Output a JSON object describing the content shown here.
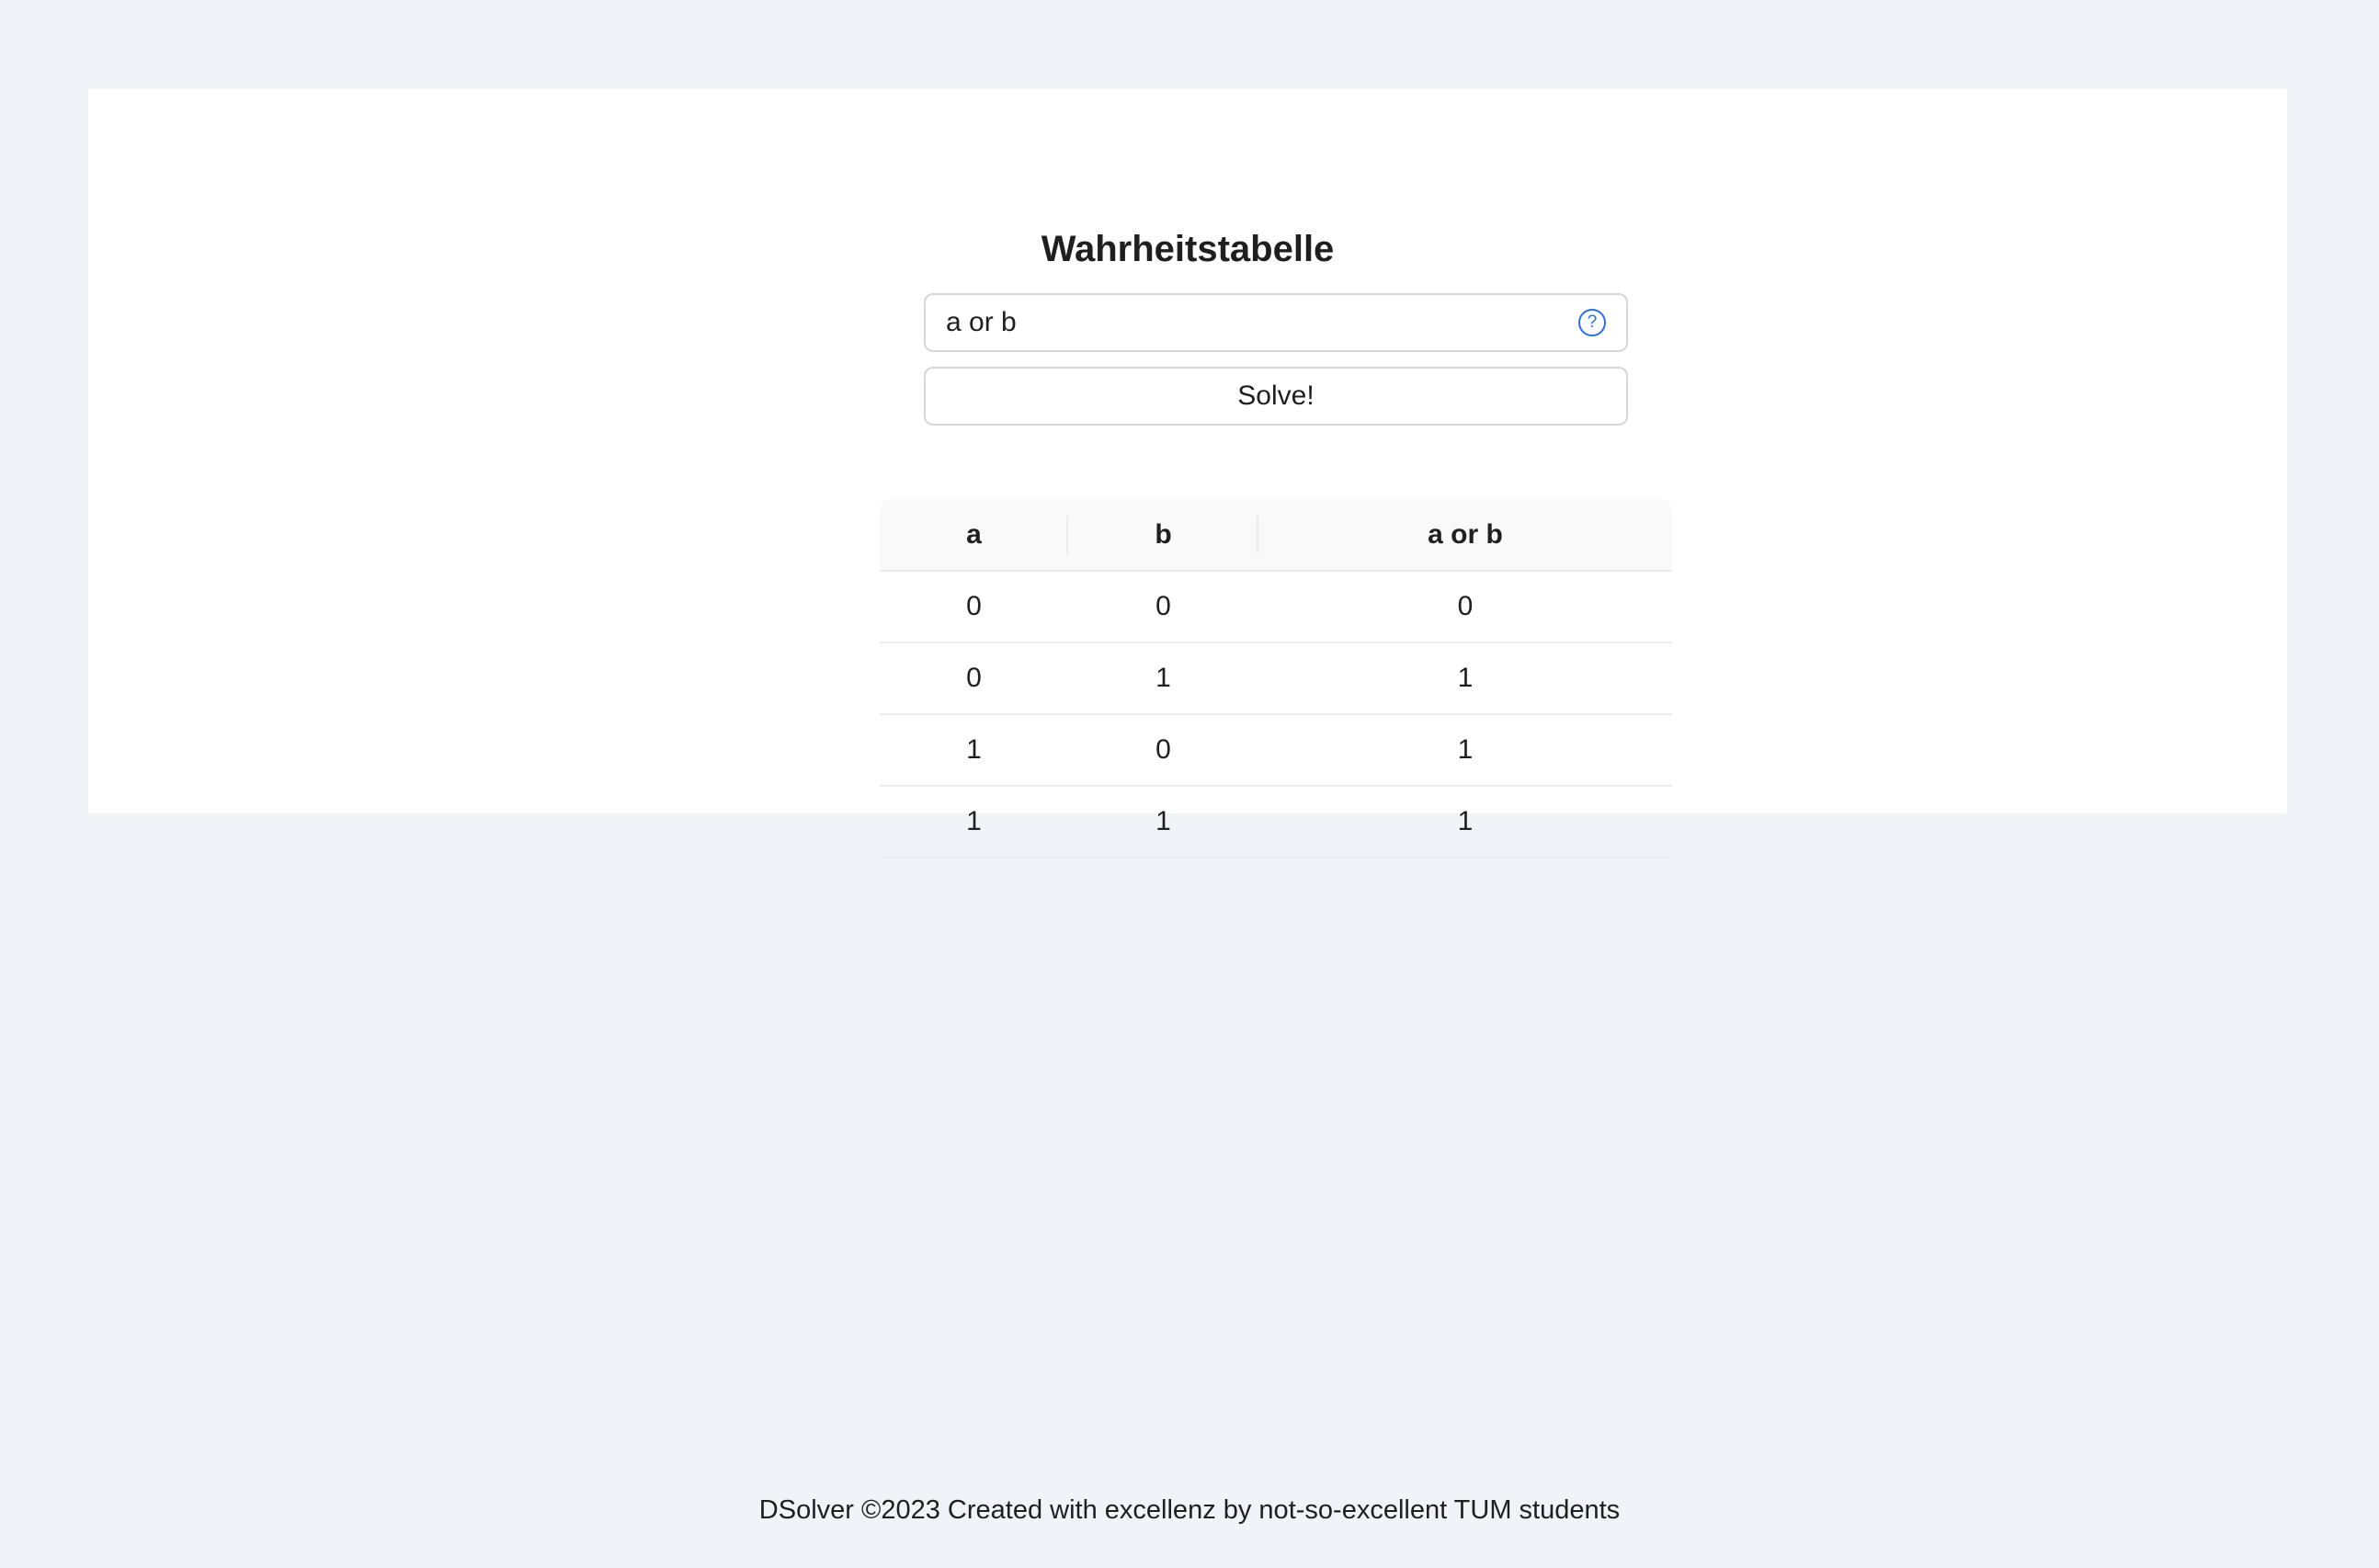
{
  "page": {
    "title": "Wahrheitstabelle"
  },
  "form": {
    "expression_value": "a or b",
    "help_icon": "question-circle-icon",
    "help_symbol": "?",
    "solve_label": "Solve!"
  },
  "table": {
    "headers": [
      "a",
      "b",
      "a or b"
    ],
    "rows": [
      [
        "0",
        "0",
        "0"
      ],
      [
        "0",
        "1",
        "1"
      ],
      [
        "1",
        "0",
        "1"
      ],
      [
        "1",
        "1",
        "1"
      ]
    ]
  },
  "footer": {
    "text": "DSolver ©2023 Created with excellenz by not-so-excellent TUM students"
  },
  "colors": {
    "background": "#f0f3f8",
    "card": "#ffffff",
    "accent": "#2f6fe0"
  }
}
